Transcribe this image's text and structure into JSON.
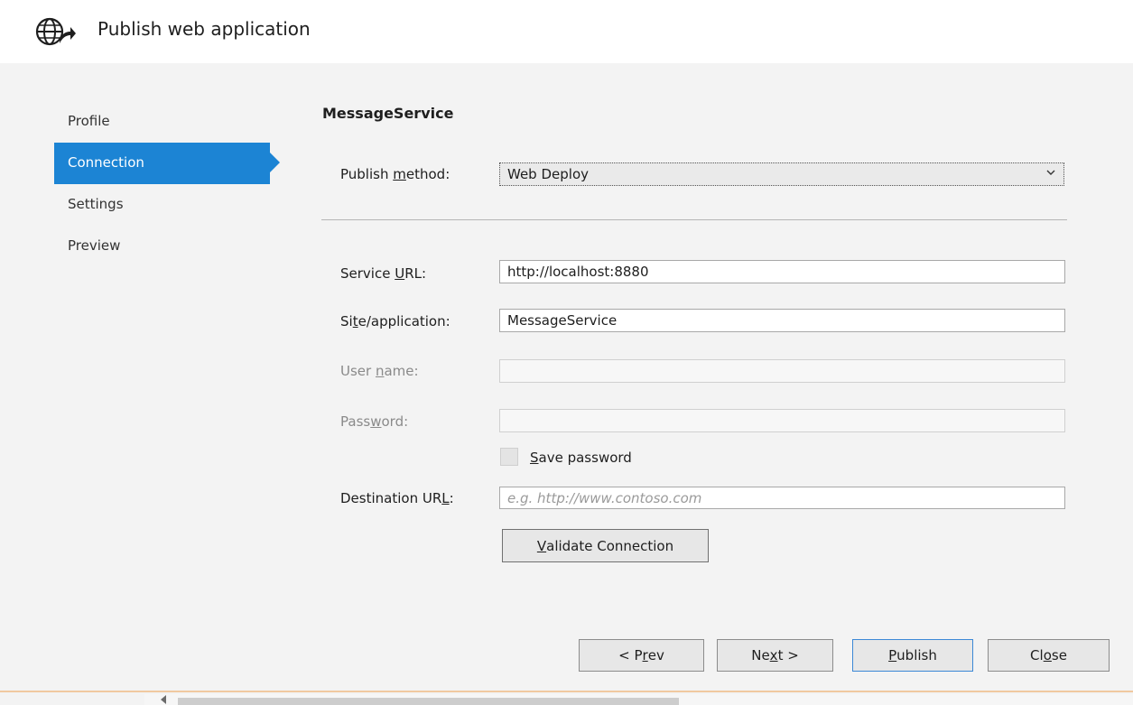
{
  "window": {
    "title": "Publish web application",
    "icon": "globe-publish-icon"
  },
  "nav": {
    "items": [
      {
        "label": "Profile",
        "active": false
      },
      {
        "label": "Connection",
        "active": true
      },
      {
        "label": "Settings",
        "active": false
      },
      {
        "label": "Preview",
        "active": false
      }
    ]
  },
  "profile_name": "MessageService",
  "form": {
    "publish_method": {
      "label_pre": "Publish ",
      "label_key": "m",
      "label_post": "ethod:",
      "value": "Web Deploy"
    },
    "service_url": {
      "label_pre": "Service ",
      "label_key": "U",
      "label_post": "RL:",
      "value": "http://localhost:8880"
    },
    "site_application": {
      "label_pre": "Si",
      "label_key": "t",
      "label_post": "e/application:",
      "value": "MessageService"
    },
    "user_name": {
      "label_pre": "User ",
      "label_key": "n",
      "label_post": "ame:",
      "value": ""
    },
    "password": {
      "label_pre": "Pass",
      "label_key": "w",
      "label_post": "ord:",
      "value": ""
    },
    "save_password": {
      "label_key": "S",
      "label_post": "ave password",
      "checked": false
    },
    "destination_url": {
      "label_pre": "Destination UR",
      "label_key": "L",
      "label_post": ":",
      "value": "",
      "placeholder": "e.g. http://www.contoso.com"
    },
    "validate": {
      "label_key": "V",
      "label_post": "alidate Connection"
    }
  },
  "buttons": {
    "prev": {
      "label_pre": "< P",
      "label_key": "r",
      "label_post": "ev"
    },
    "next": {
      "label_pre": "Ne",
      "label_key": "x",
      "label_post": "t >"
    },
    "publish": {
      "label_pre": "",
      "label_key": "P",
      "label_post": "ublish"
    },
    "close": {
      "label_pre": "Cl",
      "label_key": "o",
      "label_post": "se"
    }
  },
  "colors": {
    "accent": "#1c84d4",
    "publish_border": "#3c88d6",
    "disabled_text": "#8a8a8a"
  }
}
